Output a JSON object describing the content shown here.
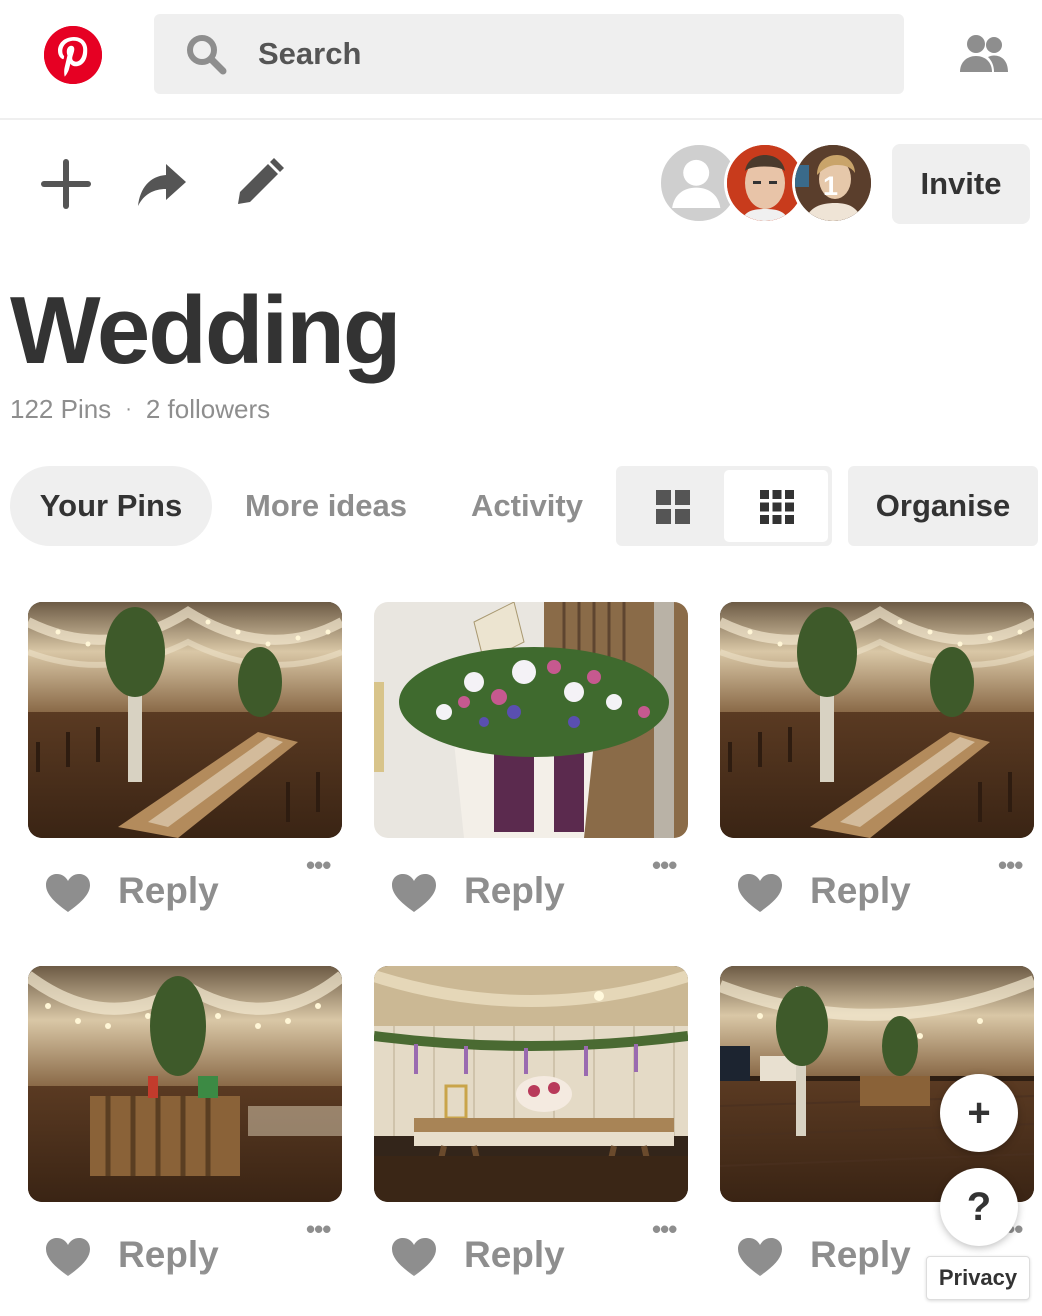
{
  "header": {
    "logo_icon": "pinterest-logo",
    "search_placeholder": "Search",
    "people_icon": "people-icon"
  },
  "board": {
    "toolbar_icons": [
      "plus-icon",
      "share-arrow-icon",
      "pencil-icon"
    ],
    "collaborators": [
      {
        "label": "",
        "color": "#cfcfcf"
      },
      {
        "label": "",
        "color": "#c83b1c"
      },
      {
        "label": "1",
        "color": "#6a4a35"
      }
    ],
    "invite_label": "Invite",
    "title": "Wedding",
    "pins_count": "122 Pins",
    "separator": "·",
    "followers": "2 followers"
  },
  "tabs": {
    "your_pins": "Your Pins",
    "more_ideas": "More ideas",
    "activity": "Activity",
    "organise": "Organise",
    "view_icons": [
      "grid-large-icon",
      "grid-small-icon"
    ]
  },
  "pins": [
    {
      "scene": "marquee-tables",
      "reply": "Reply",
      "more": "•••"
    },
    {
      "scene": "church-flowers",
      "reply": "Reply",
      "more": "•••"
    },
    {
      "scene": "marquee-tables",
      "reply": "Reply",
      "more": "•••"
    },
    {
      "scene": "marquee-bar",
      "reply": "Reply",
      "more": "•••"
    },
    {
      "scene": "marquee-table-display",
      "reply": "Reply",
      "more": "•••"
    },
    {
      "scene": "marquee-floor",
      "reply": "Reply",
      "more": "•••"
    }
  ],
  "floating": {
    "add": "+",
    "help": "?",
    "privacy": "Privacy"
  },
  "colors": {
    "brand": "#e60023",
    "muted": "#8e8e8e",
    "chip": "#efefef"
  }
}
